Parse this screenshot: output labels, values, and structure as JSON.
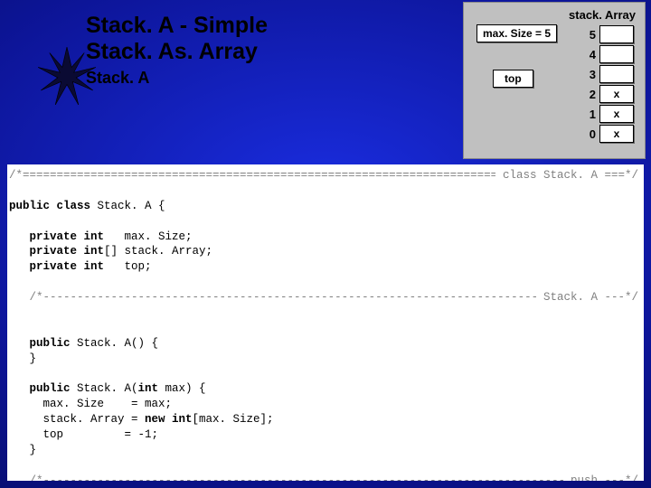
{
  "title": {
    "line1": "Stack. A   -   Simple",
    "line2": "Stack. As. Array",
    "sub": "Stack. A"
  },
  "panel": {
    "label": "stack. Array",
    "maxsize_text": "max. Size = 5",
    "top_text": "top",
    "rows": [
      {
        "idx": "5",
        "val": ""
      },
      {
        "idx": "4",
        "val": ""
      },
      {
        "idx": "3",
        "val": ""
      },
      {
        "idx": "2",
        "val": "x"
      },
      {
        "idx": "1",
        "val": "x"
      },
      {
        "idx": "0",
        "val": "x"
      }
    ]
  },
  "code": {
    "cls_open": "/*",
    "cls_label": " class Stack. A ===*/",
    "l_classdecl_a": "public class",
    "l_classdecl_b": " Stack. A {",
    "l_f1_a": "   private int",
    "l_f1_b": "   max. Size;",
    "l_f2_a": "   private int",
    "l_f2_b": "[] stack. Array;",
    "l_f3_a": "   private int",
    "l_f3_b": "   top;",
    "ctor_open": "   /*",
    "ctor_label": " Stack. A ---*/",
    "l_c1_a": "   public",
    "l_c1_b": " Stack. A() {",
    "l_c1_c": "   }",
    "l_c2_a": "   public",
    "l_c2_b": " Stack. A(",
    "l_c2_c": "int",
    "l_c2_d": " max) {",
    "l_c2_body1": "     max. Size    = max;",
    "l_c2_body2a": "     stack. Array = ",
    "l_c2_body2b": "new int",
    "l_c2_body2c": "[max. Size];",
    "l_c2_body3": "     top         = -1;",
    "l_c2_end": "   }",
    "push_open": "   /*",
    "push_label": " push ---*/"
  }
}
